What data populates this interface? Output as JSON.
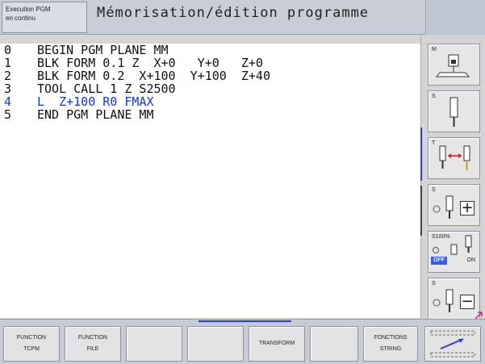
{
  "header": {
    "mode_line1": "Execution PGM",
    "mode_line2": "en continu",
    "title": "Mémorisation/édition programme"
  },
  "program": {
    "lines": [
      {
        "num": "0",
        "code": "BEGIN PGM PLANE MM"
      },
      {
        "num": "1",
        "code": "BLK FORM 0.1 Z  X+0   Y+0   Z+0"
      },
      {
        "num": "2",
        "code": "BLK FORM 0.2  X+100  Y+100  Z+40"
      },
      {
        "num": "3",
        "code": "TOOL CALL 1 Z S2500"
      },
      {
        "num": "4",
        "code": "L  Z+100 R0 FMAX"
      },
      {
        "num": "5",
        "code": "END PGM PLANE MM"
      }
    ]
  },
  "right_softkeys": {
    "m_letter": "M",
    "s_letter": "S",
    "t_letter": "T",
    "s_plus_letter": "S",
    "plus_symbol": "+",
    "override_label": "S100%",
    "off_label": "OFF",
    "on_label": "ON",
    "s_minus_letter": "S",
    "minus_symbol": "−"
  },
  "bottom_softkeys": {
    "fn_tcpm_line1": "FUNCTION",
    "fn_tcpm_line2": "TCPM",
    "fn_file_line1": "FUNCTION",
    "fn_file_line2": "FILE",
    "transform": "TRANSFORM",
    "fn_string_line1": "FONCTIONS",
    "fn_string_line2": "STRING"
  },
  "colors": {
    "active_line": "#1737c9",
    "accent_marker": "#2b3fd8"
  }
}
